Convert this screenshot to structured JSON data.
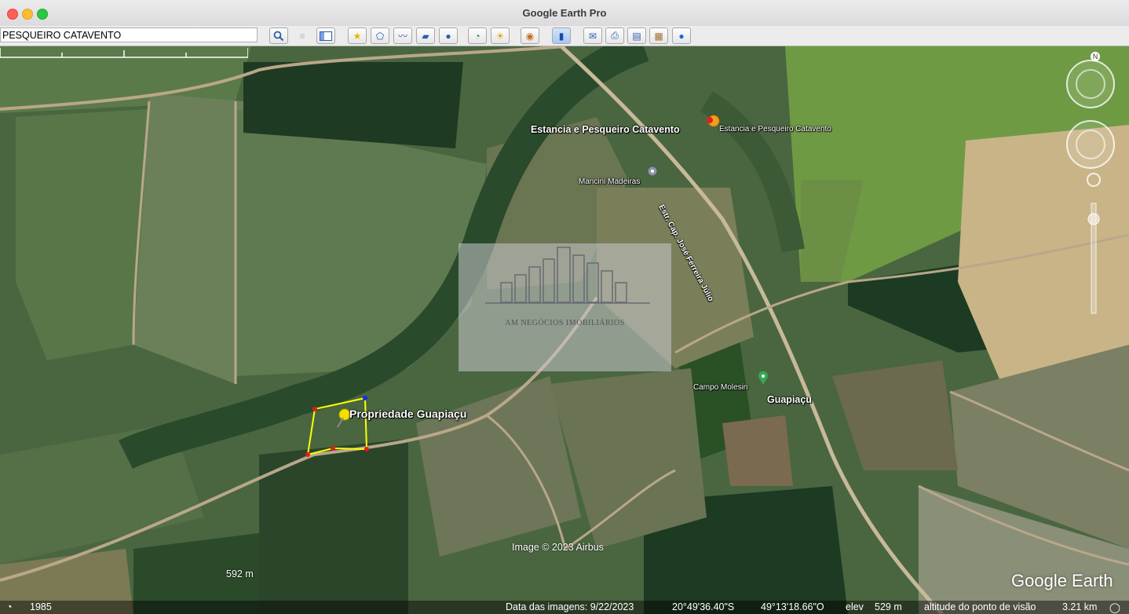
{
  "window": {
    "title": "Google Earth Pro"
  },
  "search": {
    "value": "PESQUEIRO CATAVENTO"
  },
  "toolbar": {
    "icons": [
      "search-icon",
      "separator",
      "sidebar-icon",
      "placemark-icon",
      "polygon-icon",
      "path-icon",
      "overlay-icon",
      "record-tour-icon",
      "historical-imagery-icon",
      "sunlight-icon",
      "planets-icon",
      "ruler-icon",
      "email-icon",
      "print-icon",
      "save-image-icon",
      "view-in-maps-icon",
      "earth-icon"
    ]
  },
  "map": {
    "labels": {
      "estancia_big": "Estancia e Pesqueiro Catavento",
      "estancia_small": "Estancia e Pesqueiro Catavento",
      "mancini": "Mancini Madeiras",
      "road": "Estr. Cap. José Ferreira Júlio",
      "propriedade": "Propriedade Guapiaçu",
      "campo": "Campo Molesin",
      "guapiacu": "Guapiaçu"
    },
    "watermark": "AM NEGÓCIOS IMOBILIÁRIOS",
    "copyright": "Image © 2023 Airbus",
    "logo": "Google Earth",
    "scale": "592 m",
    "compass": "N"
  },
  "status": {
    "year": "1985",
    "date": "Data das imagens: 9/22/2023",
    "lat": "20°49'36.40\"S",
    "lon": "49°13'18.66\"O",
    "elev_label": "elev",
    "elev": "529 m",
    "alt_label": "altitude do ponto de visão",
    "alt": "3.21 km"
  }
}
